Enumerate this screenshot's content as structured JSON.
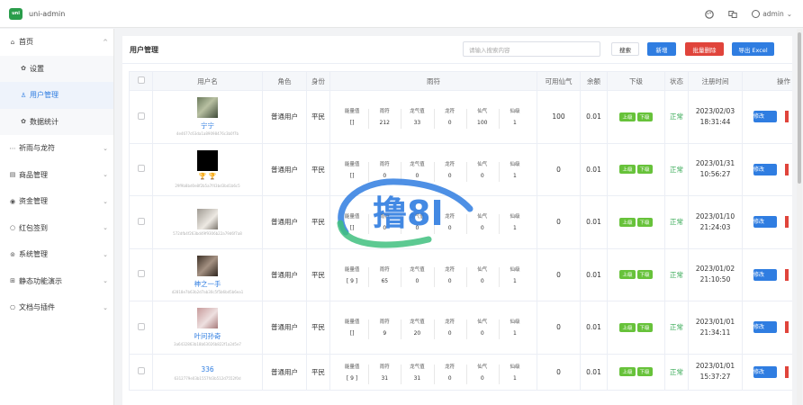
{
  "app": {
    "title": "uni-admin",
    "logo_text": "uni"
  },
  "topbar": {
    "user": "admin"
  },
  "sidebar": {
    "items": [
      {
        "icon": "home-icon",
        "glyph": "⌂",
        "label": "首页",
        "chev": "^",
        "type": "group"
      },
      {
        "icon": "gear-icon",
        "glyph": "✿",
        "label": "设置",
        "type": "sub"
      },
      {
        "icon": "user-icon",
        "glyph": "♙",
        "label": "用户管理",
        "type": "sub-active"
      },
      {
        "icon": "gear-icon",
        "glyph": "✿",
        "label": "数据统计",
        "type": "sub"
      },
      {
        "icon": "dots-icon",
        "glyph": "⋯",
        "label": "祈雨与龙符",
        "chev": "⌄",
        "type": "group"
      },
      {
        "icon": "store-icon",
        "glyph": "▤",
        "label": "商品管理",
        "chev": "⌄",
        "type": "group"
      },
      {
        "icon": "eye-icon",
        "glyph": "◉",
        "label": "资金管理",
        "chev": "⌄",
        "type": "group"
      },
      {
        "icon": "circle-icon",
        "glyph": "○",
        "label": "红包签到",
        "chev": "⌄",
        "type": "group"
      },
      {
        "icon": "system-icon",
        "glyph": "⊚",
        "label": "系统管理",
        "chev": "⌄",
        "type": "group"
      },
      {
        "icon": "grid-icon",
        "glyph": "⊞",
        "label": "静态功能演示",
        "chev": "⌄",
        "type": "group"
      },
      {
        "icon": "plugin-icon",
        "glyph": "⎔",
        "label": "文档与插件",
        "chev": "⌄",
        "type": "group"
      }
    ]
  },
  "page": {
    "title": "用户管理",
    "search_placeholder": "请输入搜索内容",
    "search_button": "搜索",
    "add_button": "新增",
    "batch_delete_button": "批量删除",
    "export_button": "导出 Excel"
  },
  "table": {
    "headers": [
      "用户名",
      "角色",
      "身份",
      "雨符",
      "可用仙气",
      "余额",
      "下级",
      "状态",
      "注册时间",
      "操作"
    ],
    "asset_labels": [
      "能量值",
      "雨符",
      "龙气值",
      "龙符",
      "仙气",
      "仙级"
    ],
    "tag_up": "上级",
    "tag_down": "下级",
    "edit_label": "修改",
    "rows": [
      {
        "name": "宁宁",
        "trophy": "",
        "uid": "4e4677c63da1a89098476c3b0f7b",
        "role": "普通用户",
        "identity": "平民",
        "assets": [
          "[]",
          "212",
          "33",
          "0",
          "100",
          "1"
        ],
        "available": "100",
        "balance": "0.01",
        "status": "正常",
        "date": "2023/02/03",
        "time": "18:31:44"
      },
      {
        "name": "",
        "trophy": "🏆 🏆",
        "uid": "29f9b8bd0e8f2b5a7f43bd3bd1b6c5",
        "role": "普通用户",
        "identity": "平民",
        "assets": [
          "[]",
          "0",
          "0",
          "0",
          "0",
          "1"
        ],
        "available": "0",
        "balance": "0.01",
        "status": "正常",
        "date": "2023/01/31",
        "time": "10:56:27"
      },
      {
        "name": "",
        "trophy": "",
        "uid": "572dfb4f263bd49f9306b22a79d6f7a8",
        "role": "普通用户",
        "identity": "平民",
        "assets": [
          "[]",
          "0",
          "0",
          "0",
          "0",
          "1"
        ],
        "available": "0",
        "balance": "0.01",
        "status": "正常",
        "date": "2023/01/10",
        "time": "21:24:03"
      },
      {
        "name": "神之一手",
        "trophy": "",
        "uid": "d2818e7b63b2d7ab30c5f5b6bd5b6ea1",
        "role": "普通用户",
        "identity": "平民",
        "assets": [
          "[ 9 ]",
          "65",
          "0",
          "0",
          "0",
          "1"
        ],
        "available": "0",
        "balance": "0.01",
        "status": "正常",
        "date": "2023/01/02",
        "time": "21:10:50"
      },
      {
        "name": "叶问孙奇",
        "trophy": "",
        "uid": "3a6432863b18b63026b822f1a2d5e7",
        "role": "普通用户",
        "identity": "平民",
        "assets": [
          "[]",
          "9",
          "20",
          "0",
          "0",
          "1"
        ],
        "available": "0",
        "balance": "0.01",
        "status": "正常",
        "date": "2023/01/01",
        "time": "21:34:11"
      },
      {
        "name": "336",
        "trophy": "",
        "uid": "6312779e03b1557fd3b512d7552f0d",
        "role": "普通用户",
        "identity": "平民",
        "assets": [
          "[ 9 ]",
          "31",
          "31",
          "0",
          "0",
          "1"
        ],
        "available": "0",
        "balance": "0.01",
        "status": "正常",
        "date": "2023/01/01",
        "time": "15:37:27"
      }
    ]
  },
  "watermark": {
    "text": "撸8I"
  },
  "colors": {
    "primary": "#2f7de1",
    "danger": "#e0443b",
    "success": "#67c23a",
    "status_green": "#34a853"
  }
}
